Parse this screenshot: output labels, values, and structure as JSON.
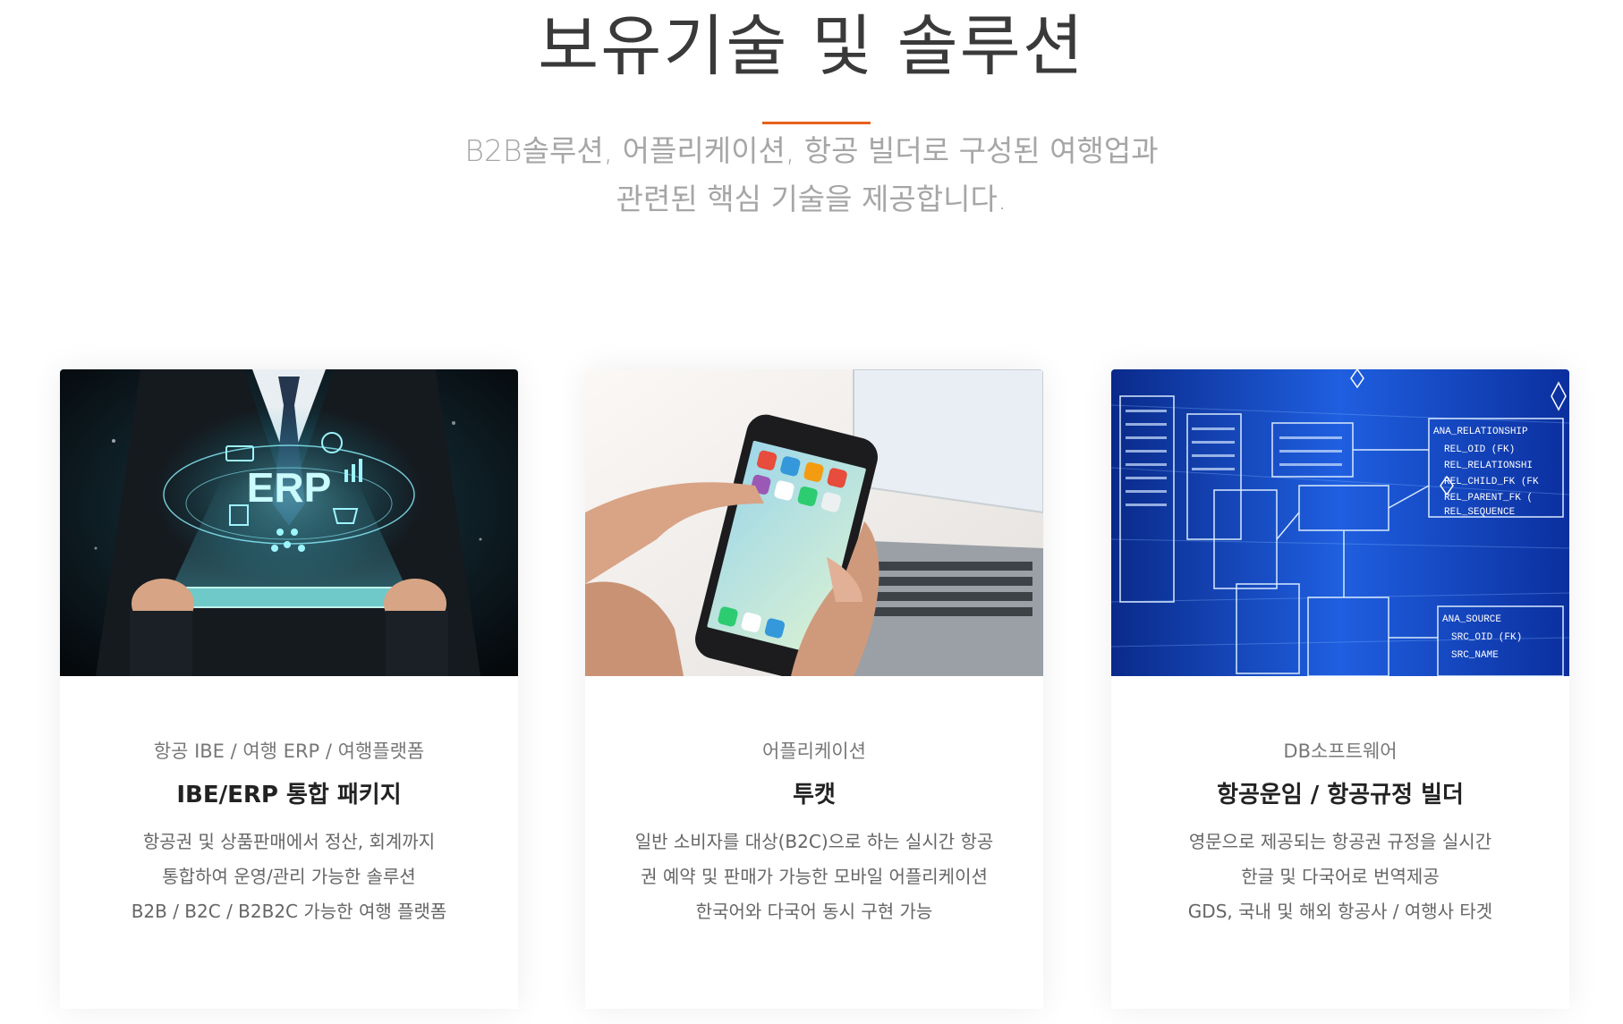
{
  "section": {
    "title": "보유기술 및 솔루션",
    "subtitle_lines": [
      "B2B솔루션, 어플리케이션, 항공 빌더로 구성된 여행업과",
      "관련된 핵심 기술을 제공합니다."
    ]
  },
  "colors": {
    "accent": "#e8601c",
    "title": "#3a3a3a",
    "subtitle": "#a6a6a6"
  },
  "cards": [
    {
      "image_alt": "erp-hologram-tablet-image",
      "image_text": "ERP",
      "category": "항공 IBE / 여행 ERP / 여행플랫폼",
      "heading": "IBE/ERP 통합 패키지",
      "desc": [
        "항공권 및 상품판매에서 정산, 회계까지",
        "통합하여 운영/관리 가능한 솔루션",
        "B2B / B2C / B2B2C 가능한 여행 플랫폼"
      ]
    },
    {
      "image_alt": "smartphone-in-hands-image",
      "category": "어플리케이션",
      "heading": "투캣",
      "desc": [
        "일반 소비자를 대상(B2C)으로 하는 실시간 항공",
        "권 예약 및 판매가 가능한 모바일 어플리케이션",
        "한국어와 다국어 동시 구현 가능"
      ]
    },
    {
      "image_alt": "database-schema-diagram-image",
      "image_labels": [
        "ANA_RELATIONSHIP",
        "REL_OID (FK)",
        "REL_RELATIONSHI",
        "REL_CHILD_FK (FK",
        "REL_PARENT_FK (",
        "REL_SEQUENCE",
        "ANA_SOURCE",
        "SRC_OID (FK)",
        "SRC_NAME"
      ],
      "category": "DB소프트웨어",
      "heading": "항공운임 / 항공규정 빌더",
      "desc": [
        "영문으로 제공되는 항공권 규정을 실시간",
        "한글 및 다국어로 번역제공",
        "GDS, 국내 및 해외 항공사 / 여행사 타겟"
      ]
    }
  ]
}
